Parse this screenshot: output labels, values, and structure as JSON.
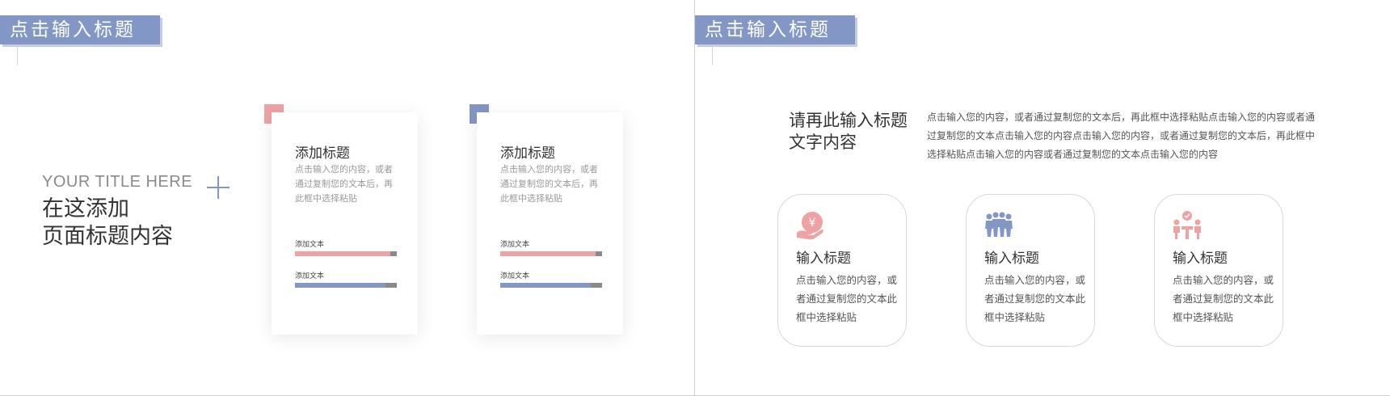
{
  "left_slide": {
    "title_bar": "点击输入标题",
    "en_title": "YOUR TITLE HERE",
    "cn_title_line1": "在这添加",
    "cn_title_line2": "页面标题内容",
    "cards": [
      {
        "title": "添加标题",
        "body": "点击输入您的内容，或者通过复制您的文本后，再此框中选择粘贴",
        "bars": [
          {
            "label": "添加文本",
            "value": 0.94,
            "color": "#eea2a3"
          },
          {
            "label": "添加文本",
            "value": 0.89,
            "color": "#8397c6"
          }
        ],
        "accent": "#eea2a3"
      },
      {
        "title": "添加标题",
        "body": "点击输入您的内容，或者通过复制您的文本后，再此框中选择粘贴",
        "bars": [
          {
            "label": "添加文本",
            "value": 0.94,
            "color": "#eea2a3"
          },
          {
            "label": "添加文本",
            "value": 0.89,
            "color": "#8397c6"
          }
        ],
        "accent": "#8397c6"
      }
    ]
  },
  "right_slide": {
    "title_bar": "点击输入标题",
    "intro_head": "请再此输入标题文字内容",
    "intro_body": "点击输入您的内容，或者通过复制您的文本后，再此框中选择粘贴点击输入您的内容或者通过复制您的文本点击输入您的内容点击输入您的内容，或者通过复制您的文本后，再此框中选择粘贴点击输入您的内容或者通过复制您的文本点击输入您的内容",
    "features": [
      {
        "icon": "money-hand-icon",
        "icon_color": "#eea2a3",
        "title": "输入标题",
        "body": "点击输入您的内容，或者通过复制您的文本此框中选择粘贴"
      },
      {
        "icon": "team-icon",
        "icon_color": "#8397c6",
        "title": "输入标题",
        "body": "点击输入您的内容，或者通过复制您的文本此框中选择粘贴"
      },
      {
        "icon": "meeting-icon",
        "icon_color": "#eea2a3",
        "title": "输入标题",
        "body": "点击输入您的内容，或者通过复制您的文本此框中选择粘贴"
      }
    ]
  },
  "colors": {
    "brand_blue": "#8397c6",
    "brand_pink": "#eea2a3"
  }
}
